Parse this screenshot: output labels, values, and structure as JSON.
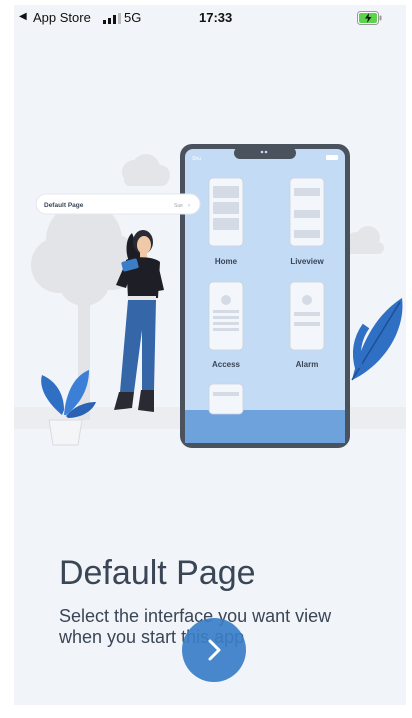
{
  "status_bar": {
    "back_label": "App Store",
    "network": "5G",
    "time": "17:33"
  },
  "illustration": {
    "tooltip_title": "Default Page",
    "tooltip_action": "Sue",
    "phone_status_left": "Shu",
    "items": [
      {
        "label": "Home"
      },
      {
        "label": "Liveview"
      },
      {
        "label": "Access"
      },
      {
        "label": "Alarm"
      }
    ]
  },
  "onboarding": {
    "title": "Default Page",
    "description": "Select the interface you want view when you start this app"
  },
  "colors": {
    "accent": "#3a7ec8",
    "text": "#3a4656",
    "phone_screen": "#c3dbf4",
    "phone_frame": "#4a525e",
    "leaf": "#2f6fc4"
  },
  "icons": {
    "next": "chevron-right-icon",
    "back": "back-triangle-icon",
    "battery": "battery-charging-icon",
    "signal": "signal-bars-icon"
  }
}
